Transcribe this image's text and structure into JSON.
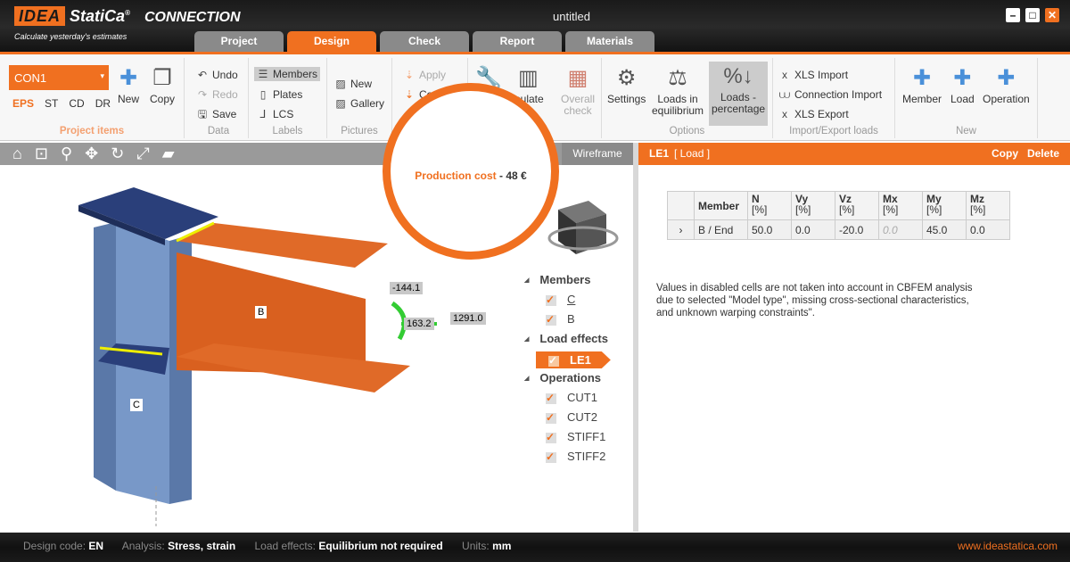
{
  "app": {
    "brand": "IDEA StatiCa",
    "brand_idea": "IDEA",
    "brand_statica": "StatiCa",
    "product": "CONNECTION",
    "tagline": "Calculate yesterday's estimates",
    "window_title": "untitled"
  },
  "tabs": [
    {
      "label": "Project"
    },
    {
      "label": "Design",
      "active": true
    },
    {
      "label": "Check"
    },
    {
      "label": "Report"
    },
    {
      "label": "Materials"
    }
  ],
  "ribbon": {
    "project_items": {
      "selected": "CON1",
      "modes": [
        "EPS",
        "ST",
        "CD",
        "DR"
      ],
      "active_mode": "EPS",
      "new": "New",
      "copy": "Copy",
      "label": "Project items"
    },
    "data": {
      "undo": "Undo",
      "redo": "Redo",
      "save": "Save",
      "label": "Data"
    },
    "labels": {
      "members": "Members",
      "plates": "Plates",
      "lcs": "LCS",
      "label": "Labels"
    },
    "pictures": {
      "new": "New",
      "gallery": "Gallery",
      "label": "Pictures"
    },
    "ops": {
      "apply": "Apply",
      "copy": "Co"
    },
    "calc": {
      "calculate": "lculate",
      "overall1": "Overall",
      "overall2": "check"
    },
    "options": {
      "settings": "Settings",
      "eq1": "Loads in",
      "eq2": "equilibrium",
      "pc1": "Loads -",
      "pc2": "percentage",
      "label": "Options"
    },
    "io": {
      "xls_import": "XLS Import",
      "conn_import": "Connection Import",
      "xls_export": "XLS Export",
      "label": "Import/Export loads"
    },
    "new": {
      "member": "Member",
      "load": "Load",
      "operation": "Operation",
      "label": "New"
    }
  },
  "viewport": {
    "wireframe": "Wireframe",
    "cost_label": "Production cost",
    "cost_sep": "-",
    "cost_value": "48 €",
    "labels": {
      "b": "B",
      "c": "C",
      "v1": "-144.1",
      "v2": "163.2",
      "v3": "1291.0"
    },
    "tree": {
      "members": "Members",
      "member_items": [
        "C",
        "B"
      ],
      "load_effects": "Load effects",
      "le": "LE1",
      "operations": "Operations",
      "op_items": [
        "CUT1",
        "CUT2",
        "STIFF1",
        "STIFF2"
      ]
    }
  },
  "panel": {
    "title": "LE1",
    "type": "[ Load ]",
    "copy": "Copy",
    "delete": "Delete",
    "columns": [
      {
        "n": "Member",
        "u": ""
      },
      {
        "n": "N",
        "u": "[%]"
      },
      {
        "n": "Vy",
        "u": "[%]"
      },
      {
        "n": "Vz",
        "u": "[%]"
      },
      {
        "n": "Mx",
        "u": "[%]"
      },
      {
        "n": "My",
        "u": "[%]"
      },
      {
        "n": "Mz",
        "u": "[%]"
      }
    ],
    "row": [
      "B / End",
      "50.0",
      "0.0",
      "-20.0",
      "0.0",
      "45.0",
      "0.0"
    ],
    "note": "Values in disabled cells are not taken into account in CBFEM analysis due to selected \"Model type\", missing cross-sectional characteristics, and unknown warping constraints\"."
  },
  "status": {
    "design_code_label": "Design code:",
    "design_code": "EN",
    "analysis_label": "Analysis:",
    "analysis": "Stress, strain",
    "load_effects_label": "Load effects:",
    "load_effects": "Equilibrium not required",
    "units_label": "Units:",
    "units": "mm",
    "website": "www.ideastatica.com"
  },
  "colors": {
    "accent": "#f07020",
    "column": "#6a8ab8",
    "flange": "#2a3f7a",
    "beam": "#d9601f"
  }
}
